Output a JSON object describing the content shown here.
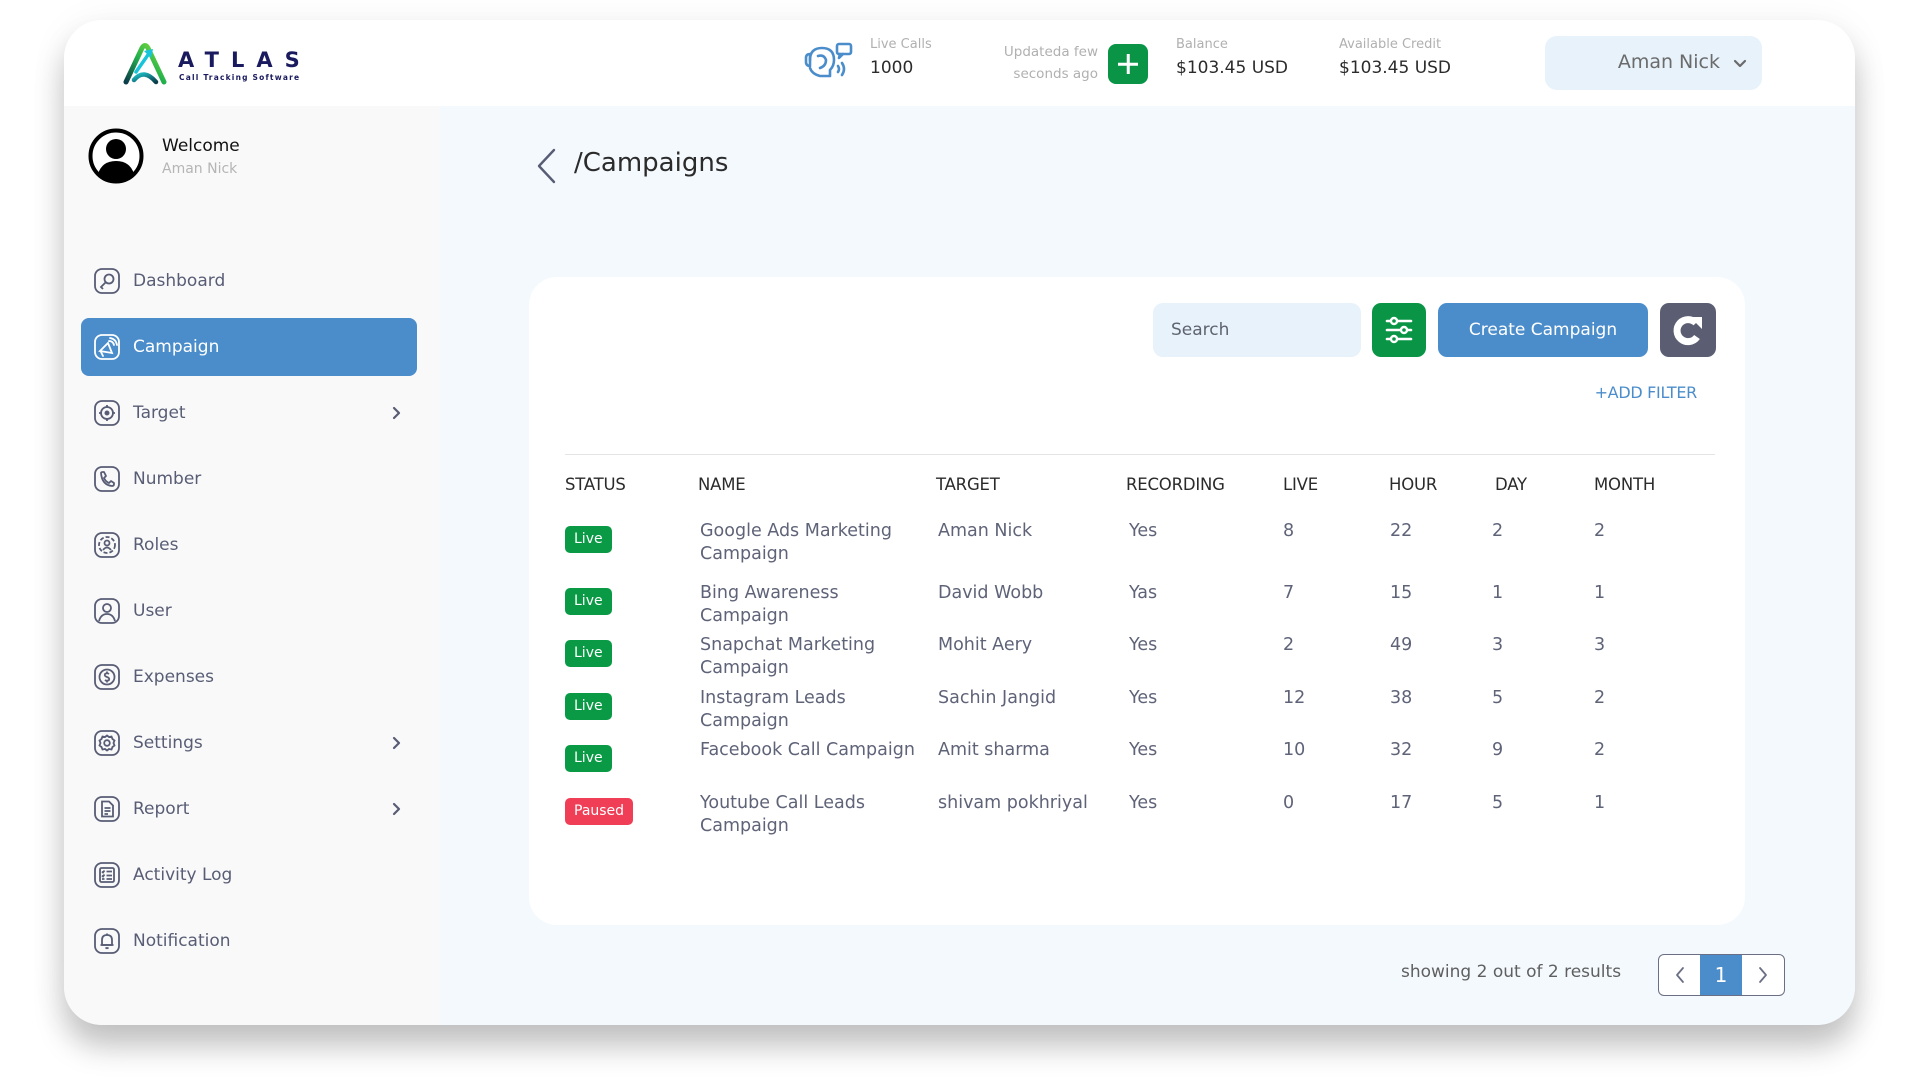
{
  "app": {
    "logo_name": "ATLAS",
    "logo_tagline": "Call Tracking Software"
  },
  "header": {
    "live_calls": {
      "label": "Live Calls",
      "value": "1000",
      "icon": "live-calls-icon"
    },
    "updated_text": "Updateda few seconds ago",
    "add_button": {
      "icon": "plus-icon"
    },
    "balance": {
      "label": "Balance",
      "value": "$103.45 USD"
    },
    "available_credit": {
      "label": "Available Credit",
      "value": "$103.45 USD"
    },
    "user_menu": {
      "name": "Aman Nick",
      "icon": "chevron-down-icon"
    }
  },
  "sidebar": {
    "welcome_title": "Welcome",
    "welcome_name": "Aman Nick",
    "items": [
      {
        "label": "Dashboard",
        "icon": "dashboard-icon",
        "active": false,
        "has_submenu": false
      },
      {
        "label": "Campaign",
        "icon": "campaign-icon",
        "active": true,
        "has_submenu": false
      },
      {
        "label": "Target",
        "icon": "target-icon",
        "active": false,
        "has_submenu": true
      },
      {
        "label": "Number",
        "icon": "phone-icon",
        "active": false,
        "has_submenu": false
      },
      {
        "label": "Roles",
        "icon": "roles-icon",
        "active": false,
        "has_submenu": false
      },
      {
        "label": "User",
        "icon": "user-icon",
        "active": false,
        "has_submenu": false
      },
      {
        "label": "Expenses",
        "icon": "expenses-icon",
        "active": false,
        "has_submenu": false
      },
      {
        "label": "Settings",
        "icon": "gear-icon",
        "active": false,
        "has_submenu": true
      },
      {
        "label": "Report",
        "icon": "report-icon",
        "active": false,
        "has_submenu": true
      },
      {
        "label": "Activity Log",
        "icon": "activity-log-icon",
        "active": false,
        "has_submenu": false
      },
      {
        "label": "Notification",
        "icon": "bell-icon",
        "active": false,
        "has_submenu": false
      }
    ]
  },
  "page": {
    "title": "/Campaigns",
    "back_icon": "chevron-left-icon"
  },
  "toolbar": {
    "search_placeholder": "Search",
    "search_value": "",
    "filter_icon": "sliders-icon",
    "create_label": "Create Campaign",
    "refresh_icon": "refresh-icon",
    "add_filter_label": "+ADD FILTER"
  },
  "table": {
    "columns": [
      "STATUS",
      "NAME",
      "TARGET",
      "RECORDING",
      "LIVE",
      "HOUR",
      "DAY",
      "MONTH"
    ],
    "rows": [
      {
        "status": "Live",
        "name": "Google Ads Marketing Campaign",
        "target": "Aman Nick",
        "recording": "Yes",
        "live": "8",
        "hour": "22",
        "day": "2",
        "month": "2"
      },
      {
        "status": "Live",
        "name": "Bing Awareness Campaign",
        "target": "David Wobb",
        "recording": "Yas",
        "live": "7",
        "hour": "15",
        "day": "1",
        "month": "1"
      },
      {
        "status": "Live",
        "name": "Snapchat Marketing Campaign",
        "target": "Mohit Aery",
        "recording": "Yes",
        "live": "2",
        "hour": "49",
        "day": "3",
        "month": "3"
      },
      {
        "status": "Live",
        "name": "Instagram Leads Campaign",
        "target": "Sachin Jangid",
        "recording": "Yes",
        "live": "12",
        "hour": "38",
        "day": "5",
        "month": "2"
      },
      {
        "status": "Live",
        "name": "Facebook Call Campaign",
        "target": "Amit sharma",
        "recording": "Yes",
        "live": "10",
        "hour": "32",
        "day": "9",
        "month": "2"
      },
      {
        "status": "Paused",
        "name": "Youtube Call Leads Campaign",
        "target": "shivam pokhriyal",
        "recording": "Yes",
        "live": "0",
        "hour": "17",
        "day": "5",
        "month": "1"
      }
    ]
  },
  "pagination": {
    "summary": "showing 2 out of 2 results",
    "current_page": "1",
    "prev_icon": "chevron-left-icon",
    "next_icon": "chevron-right-icon"
  },
  "colors": {
    "primary": "#4b8dcb",
    "success": "#0a9546",
    "danger": "#ef3e56",
    "neutral_button": "#5b5e72",
    "content_bg": "#f4f9fd",
    "input_bg": "#e7f2fb"
  }
}
